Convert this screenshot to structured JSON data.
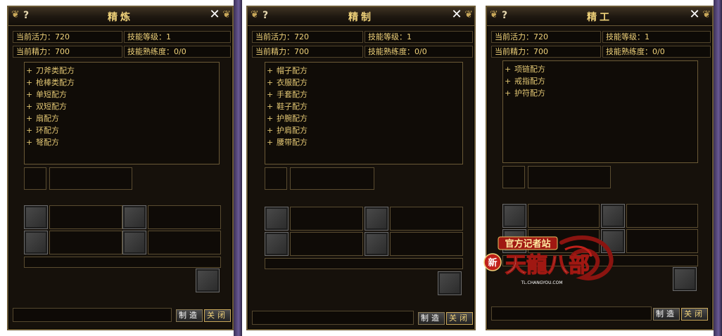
{
  "panels": [
    {
      "title": "精炼",
      "help": "?",
      "close": "✕",
      "vitality": "当前活力：720",
      "energy": "当前精力：700",
      "skill_level": "技能等级：1",
      "proficiency": "技能熟练度：0/0",
      "recipes": [
        {
          "sign": "+",
          "label": "刀斧类配方"
        },
        {
          "sign": "+",
          "label": "枪棒类配方"
        },
        {
          "sign": "+",
          "label": "单短配方"
        },
        {
          "sign": "+",
          "label": "双短配方"
        },
        {
          "sign": "+",
          "label": "扇配方"
        },
        {
          "sign": "+",
          "label": "环配方"
        },
        {
          "sign": "+",
          "label": "弩配方"
        }
      ],
      "make_button": "制造",
      "close_button": "关闭"
    },
    {
      "title": "精制",
      "help": "?",
      "close": "✕",
      "vitality": "当前活力：720",
      "energy": "当前精力：700",
      "skill_level": "技能等级：1",
      "proficiency": "技能熟练度：0/0",
      "recipes": [
        {
          "sign": "+",
          "label": "帽子配方"
        },
        {
          "sign": "+",
          "label": "衣服配方"
        },
        {
          "sign": "+",
          "label": "手套配方"
        },
        {
          "sign": "+",
          "label": "鞋子配方"
        },
        {
          "sign": "+",
          "label": "护腕配方"
        },
        {
          "sign": "+",
          "label": "护肩配方"
        },
        {
          "sign": "+",
          "label": "腰带配方"
        }
      ],
      "make_button": "制造",
      "close_button": "关闭"
    },
    {
      "title": "精工",
      "help": "?",
      "close": "✕",
      "vitality": "当前活力：720",
      "energy": "当前精力：700",
      "skill_level": "技能等级：1",
      "proficiency": "技能熟练度：0/0",
      "recipes": [
        {
          "sign": "+",
          "label": "项链配方"
        },
        {
          "sign": "+",
          "label": "戒指配方"
        },
        {
          "sign": "+",
          "label": "护符配方"
        }
      ],
      "make_button": "制造",
      "close_button": "关闭"
    }
  ],
  "logo": {
    "banner": "官方记者站",
    "badge": "新",
    "name": "天龍八部",
    "url": "TL.CHANGYOU.COM"
  },
  "colors": {
    "gold_text": "#f0d27a",
    "panel_bg": "#16110b",
    "border": "#6b5a36",
    "logo_red": "#c0201a"
  }
}
